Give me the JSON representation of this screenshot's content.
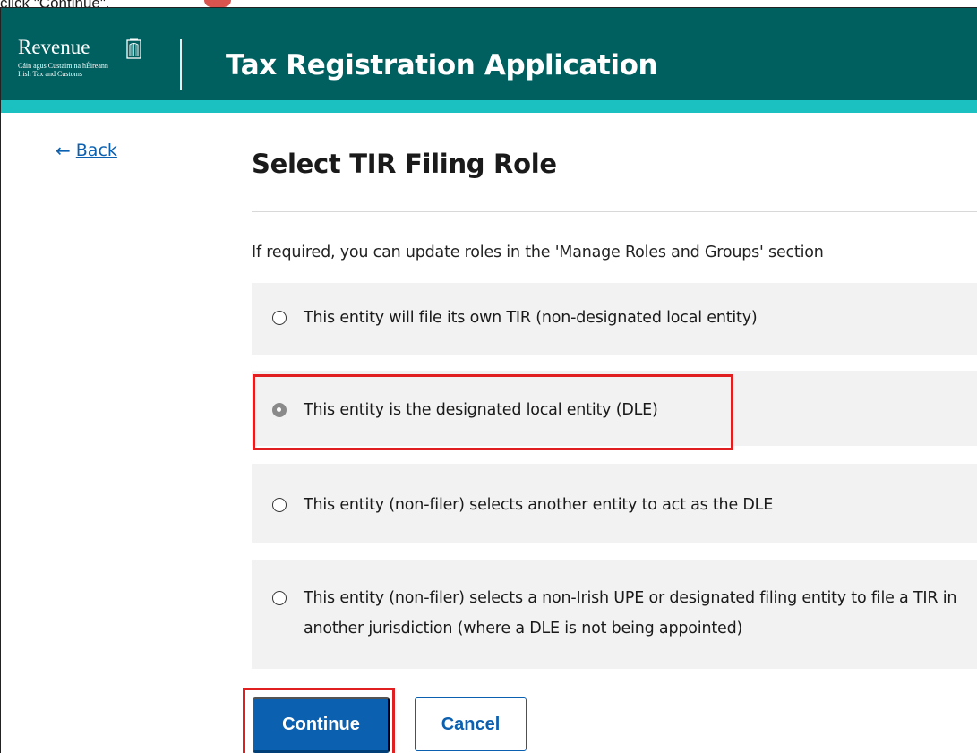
{
  "instruction_fragment": "click \"Continue\".",
  "header": {
    "logo": {
      "name": "Revenue",
      "sub_line1": "Cáin agus Custaim na hÉireann",
      "sub_line2": "Irish Tax and Customs",
      "icon": "harp-icon"
    },
    "app_title": "Tax Registration Application",
    "colors": {
      "header_bg": "#005f5f",
      "stripe": "#1bc0c0"
    }
  },
  "nav": {
    "back_label": "Back",
    "back_icon": "arrow-left-icon"
  },
  "main": {
    "title": "Select TIR Filing Role",
    "hint": "If required, you can update roles in the 'Manage Roles and Groups' section",
    "options": [
      {
        "label": "This entity will file its own TIR (non-designated local entity)",
        "selected": false
      },
      {
        "label": "This entity is the designated local entity (DLE)",
        "selected": true
      },
      {
        "label": "This entity (non-filer) selects another entity to act as the DLE",
        "selected": false
      },
      {
        "label": "This entity (non-filer) selects a non-Irish UPE or designated filing entity to file a TIR in another jurisdiction (where a DLE is not being appointed)",
        "selected": false
      }
    ],
    "buttons": {
      "continue": "Continue",
      "cancel": "Cancel"
    }
  },
  "annotations": {
    "highlight_color": "#e02020"
  }
}
